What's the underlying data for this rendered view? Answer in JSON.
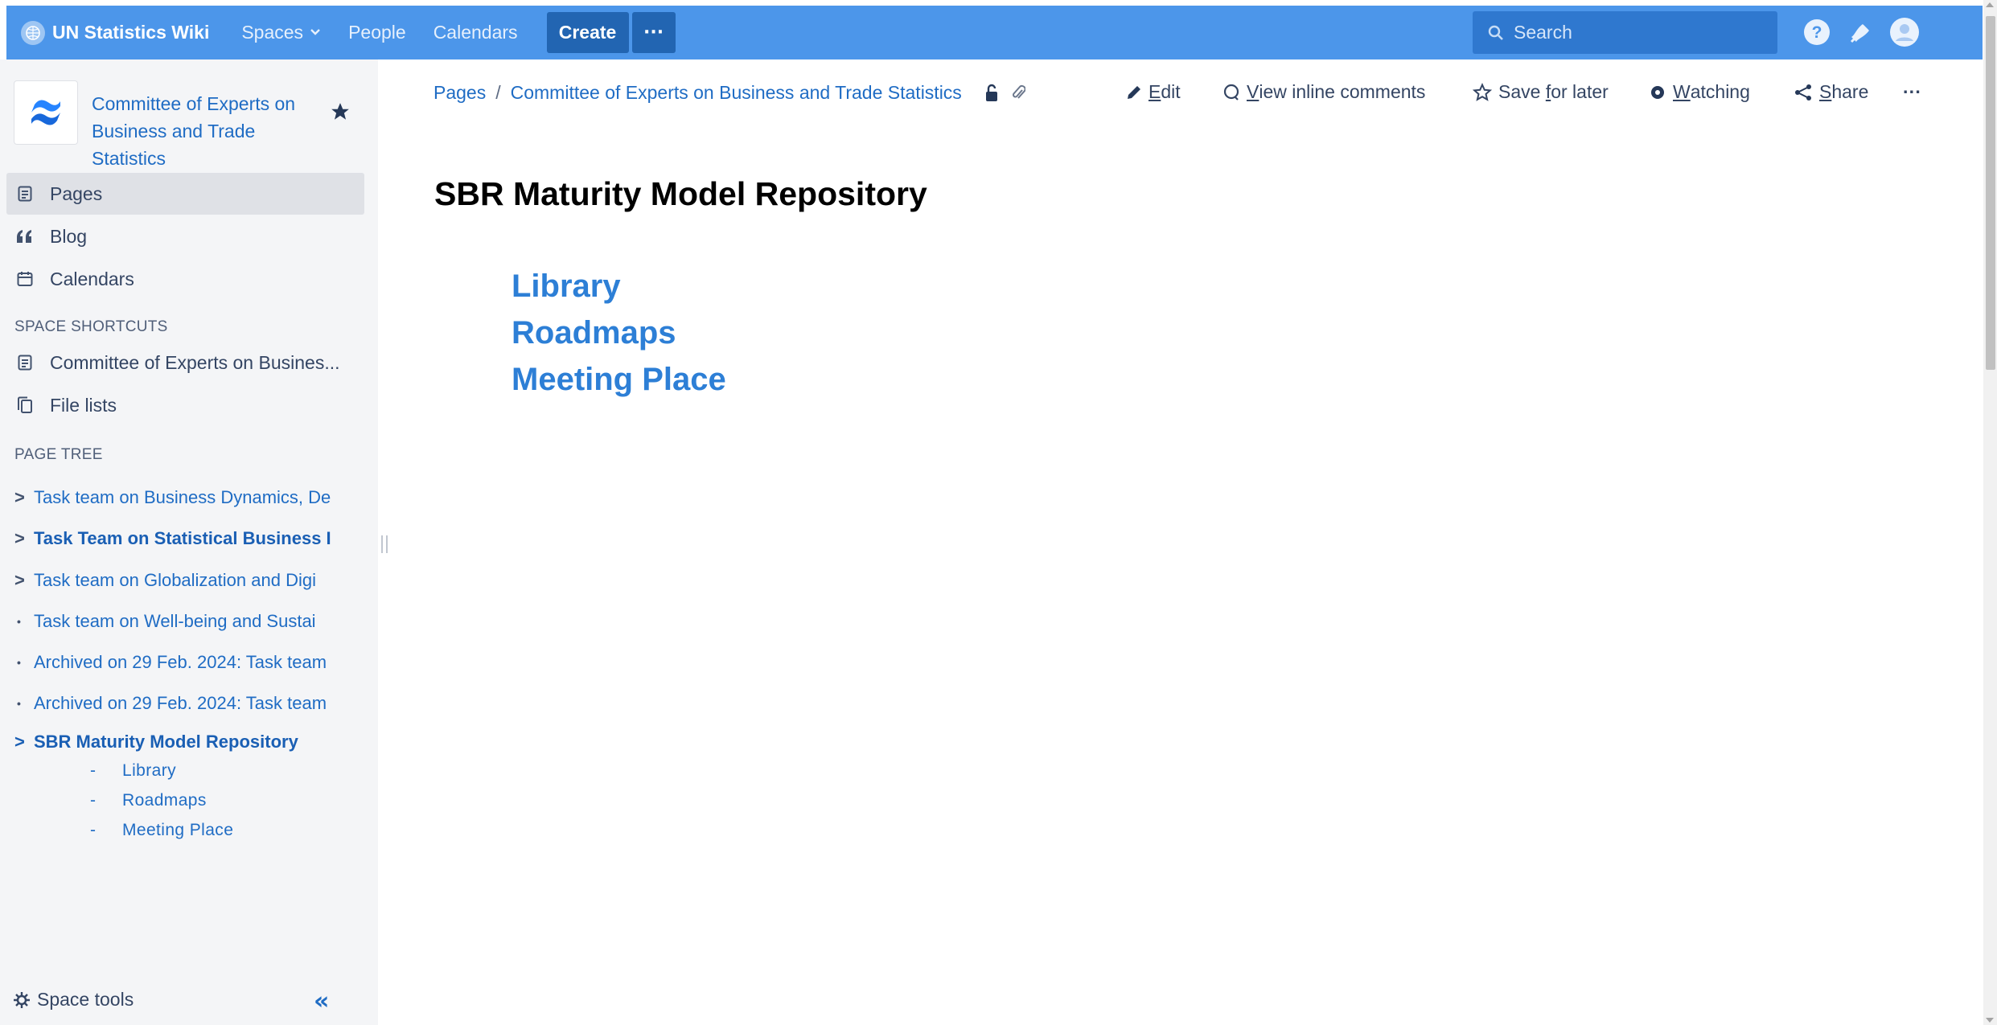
{
  "topbar": {
    "brand": "UN Statistics Wiki",
    "nav": {
      "spaces": "Spaces",
      "people": "People",
      "calendars": "Calendars"
    },
    "create": "Create",
    "more": "···",
    "search_placeholder": "Search",
    "icons": [
      "help-icon",
      "notifications-icon",
      "user-avatar-icon"
    ]
  },
  "sidebar": {
    "space_name": "Committee of Experts on Business and Trade Statistics",
    "items": [
      {
        "label": "Pages",
        "icon": "page-icon"
      },
      {
        "label": "Blog",
        "icon": "quote-icon"
      },
      {
        "label": "Calendars",
        "icon": "calendar-icon"
      }
    ],
    "shortcuts_heading": "SPACE SHORTCUTS",
    "shortcuts": [
      {
        "label": "Committee of Experts on Busines...",
        "icon": "page-icon"
      },
      {
        "label": "File lists",
        "icon": "file-list-icon"
      }
    ],
    "tree_heading": "PAGE TREE",
    "tree": [
      {
        "label": "Task team on Business Dynamics, De",
        "marker": ">"
      },
      {
        "label": "Task Team on Statistical Business I",
        "marker": ">"
      },
      {
        "label": "Task team on Globalization and Digi",
        "marker": ">"
      },
      {
        "label": "Task team on Well-being and Sustai",
        "marker": "•"
      },
      {
        "label": "Archived on 29 Feb. 2024: Task team",
        "marker": "•"
      },
      {
        "label": "Archived on 29 Feb. 2024: Task team",
        "marker": "•"
      }
    ],
    "current_page": {
      "label": "SBR Maturity Model Repository",
      "marker": ">"
    },
    "sub_pages": [
      {
        "dash": "-",
        "label": "Library"
      },
      {
        "dash": "-",
        "label": "Roadmaps"
      },
      {
        "dash": "-",
        "label": "Meeting Place"
      }
    ],
    "space_tools": "Space tools",
    "collapse": "«"
  },
  "breadcrumb": {
    "root": "Pages",
    "separator": "/",
    "parent": "Committee of Experts on Business and Trade Statistics"
  },
  "actions": {
    "edit": {
      "key": "E",
      "rest": "dit"
    },
    "comments": {
      "key": "V",
      "rest": "iew inline comments"
    },
    "save": {
      "pre": "Save ",
      "key": "f",
      "rest": "or later"
    },
    "watching": {
      "key": "W",
      "rest": "atching"
    },
    "share": {
      "key": "S",
      "rest": "hare"
    },
    "more": "···"
  },
  "content": {
    "title": "SBR Maturity Model Repository",
    "links": [
      "Library",
      "Roadmaps",
      "Meeting Place"
    ]
  },
  "colors": {
    "topbar": "#4c96ea",
    "create_button": "#2265b2",
    "link": "#1f6cc4",
    "content_link": "#2d7fd6",
    "sidebar_bg": "#f4f5f7"
  }
}
